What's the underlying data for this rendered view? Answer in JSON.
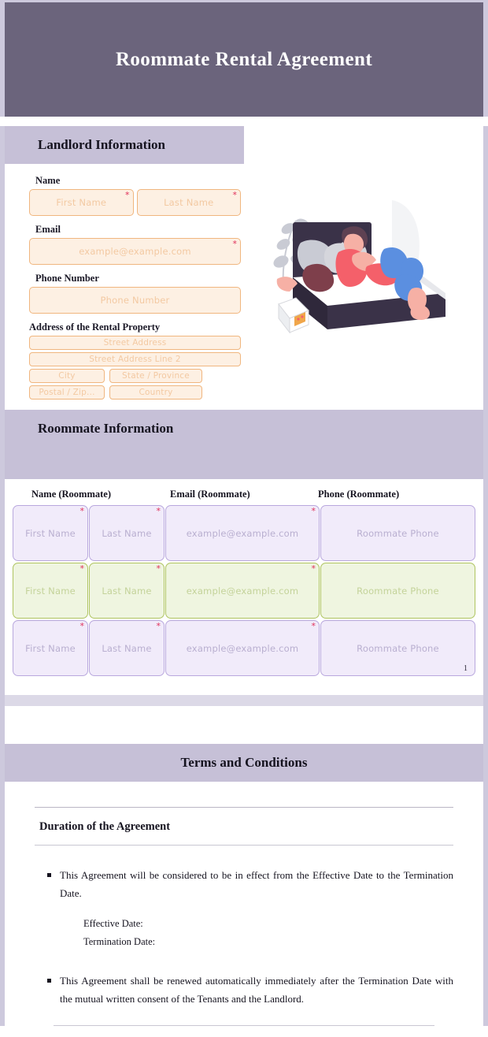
{
  "document": {
    "title": "Roommate Rental Agreement"
  },
  "landlord": {
    "section_title": "Landlord Information",
    "name_label": "Name",
    "first_name_placeholder": "First Name",
    "last_name_placeholder": "Last Name",
    "email_label": "Email",
    "email_placeholder": "example@example.com",
    "phone_label": "Phone Number",
    "phone_placeholder": "Phone Number",
    "address_label": "Address of the Rental Property",
    "street_placeholder": "Street Address",
    "street2_placeholder": "Street Address Line 2",
    "city_placeholder": "City",
    "state_placeholder": "State / Province",
    "postal_placeholder": "Postal / Zip...",
    "country_placeholder": "Country",
    "required_marker": "*"
  },
  "illustration": {
    "name": "roommates-on-bed-illustration"
  },
  "roommates": {
    "section_title": "Roommate Information",
    "columns": [
      "Name (Roommate)",
      "Email (Roommate)",
      "Phone (Roommate)"
    ],
    "row_counter": "1",
    "required_marker": "*",
    "rows": [
      {
        "style": "purple",
        "first_name": "First Name",
        "last_name": "Last Name",
        "email": "example@example.com",
        "phone": "Roommate Phone"
      },
      {
        "style": "green",
        "first_name": "First Name",
        "last_name": "Last Name",
        "email": "example@example.com",
        "phone": "Roommate Phone"
      },
      {
        "style": "purple",
        "first_name": "First Name",
        "last_name": "Last Name",
        "email": "example@example.com",
        "phone": "Roommate Phone"
      }
    ]
  },
  "terms": {
    "section_title": "Terms and Conditions",
    "subsection_title": "Duration of the Agreement",
    "bullets": [
      "This Agreement will be considered to be in effect from the Effective Date to the Termination Date.",
      "This Agreement shall be renewed automatically immediately after the Termination Date with the mutual written consent of the Tenants and the Landlord."
    ],
    "effective_date_label": "Effective Date:",
    "termination_date_label": "Termination Date:"
  },
  "colors": {
    "header_band": "#6b647c",
    "section_band": "#c6c0d7",
    "page_border": "#cdc9dd",
    "peach_field_bg": "#fdf0e3",
    "peach_field_border": "#f0b67f",
    "purple_row_bg": "#f1ebfa",
    "purple_row_border": "#b9a8de",
    "green_row_bg": "#eff5e0",
    "green_row_border": "#aec45f",
    "required_asterisk": "#e0315b"
  }
}
